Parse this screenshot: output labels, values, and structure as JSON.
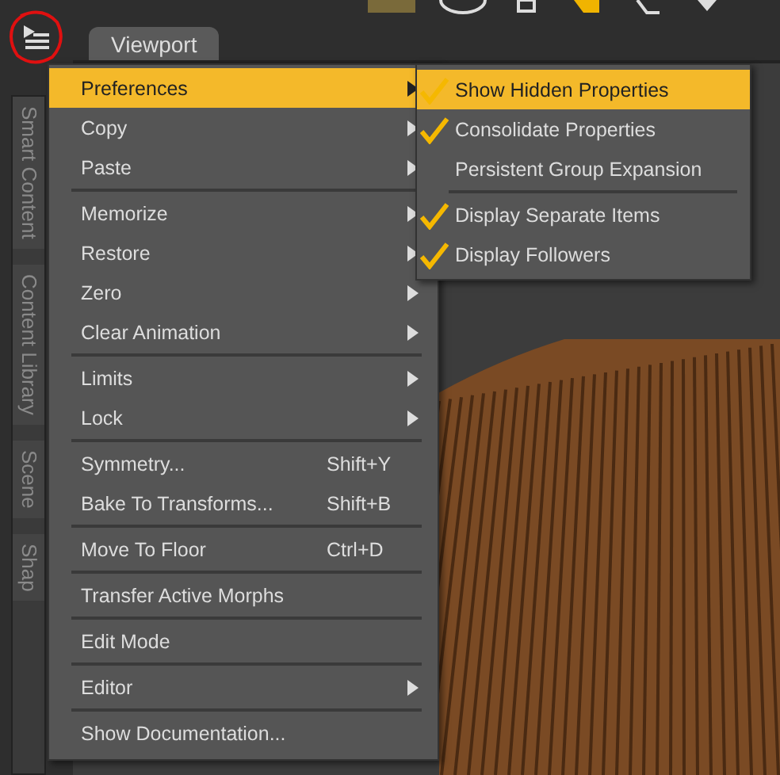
{
  "panel_tabs": [
    {
      "label": "Smart Content"
    },
    {
      "label": "Content Library"
    },
    {
      "label": "Scene"
    },
    {
      "label": "Shap"
    }
  ],
  "viewport_tab": {
    "label": "Viewport",
    "selected": true
  },
  "menu": {
    "sections": [
      [
        {
          "label": "Preferences",
          "submenu": true,
          "selected": true
        },
        {
          "label": "Copy",
          "submenu": true,
          "selected": false
        },
        {
          "label": "Paste",
          "submenu": true,
          "selected": false
        }
      ],
      [
        {
          "label": "Memorize",
          "submenu": true,
          "selected": false
        },
        {
          "label": "Restore",
          "submenu": true,
          "selected": false
        },
        {
          "label": "Zero",
          "submenu": true,
          "selected": false
        },
        {
          "label": "Clear Animation",
          "submenu": true,
          "selected": false
        }
      ],
      [
        {
          "label": "Limits",
          "submenu": true,
          "selected": false
        },
        {
          "label": "Lock",
          "submenu": true,
          "selected": false
        }
      ],
      [
        {
          "label": "Symmetry...",
          "shortcut": "Shift+Y",
          "submenu": false,
          "selected": false
        },
        {
          "label": "Bake To Transforms...",
          "shortcut": "Shift+B",
          "submenu": false,
          "selected": false
        }
      ],
      [
        {
          "label": "Move To Floor",
          "shortcut": "Ctrl+D",
          "submenu": false,
          "selected": false
        }
      ],
      [
        {
          "label": "Transfer Active Morphs",
          "submenu": false,
          "selected": false
        }
      ],
      [
        {
          "label": "Edit Mode",
          "submenu": false,
          "selected": false
        }
      ],
      [
        {
          "label": "Editor",
          "submenu": true,
          "selected": false
        }
      ],
      [
        {
          "label": "Show Documentation...",
          "submenu": false,
          "selected": false
        }
      ]
    ]
  },
  "submenu": {
    "sections": [
      [
        {
          "label": "Show Hidden Properties",
          "checked": true,
          "selected": true
        },
        {
          "label": "Consolidate Properties",
          "checked": true,
          "selected": false
        },
        {
          "label": "Persistent Group Expansion",
          "checked": false,
          "selected": false
        }
      ],
      [
        {
          "label": "Display Separate Items",
          "checked": true,
          "selected": false
        },
        {
          "label": "Display Followers",
          "checked": true,
          "selected": false
        }
      ]
    ]
  }
}
